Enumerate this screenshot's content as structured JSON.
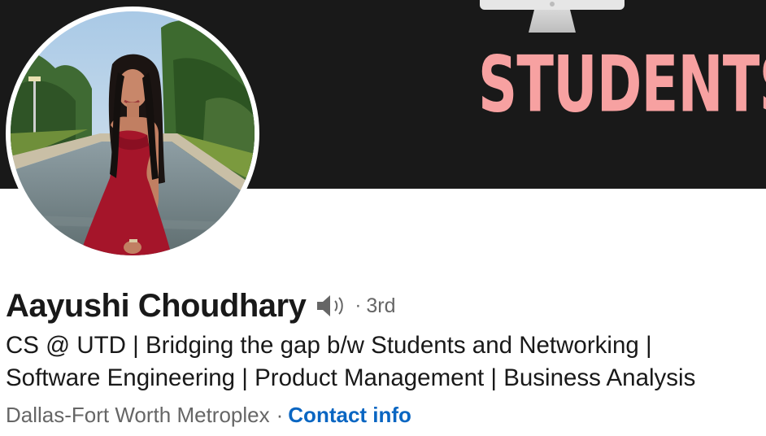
{
  "banner": {
    "word": "STUDENTS",
    "background_color": "#191919",
    "word_color": "#f7a1a1",
    "icon": "monitor-icon"
  },
  "profile": {
    "name": "Aayushi Choudhary",
    "pronunciation_icon": "speaker-icon",
    "degree_separator": "·",
    "degree": "3rd",
    "headline_lines": [
      "CS @ UTD | Bridging the gap b/w Students and Networking |",
      "Software Engineering | Product Management | Business Analysis"
    ],
    "location": "Dallas-Fort Worth Metroplex",
    "location_separator": "·",
    "contact_info_label": "Contact info",
    "link_color": "#0a66c2"
  }
}
